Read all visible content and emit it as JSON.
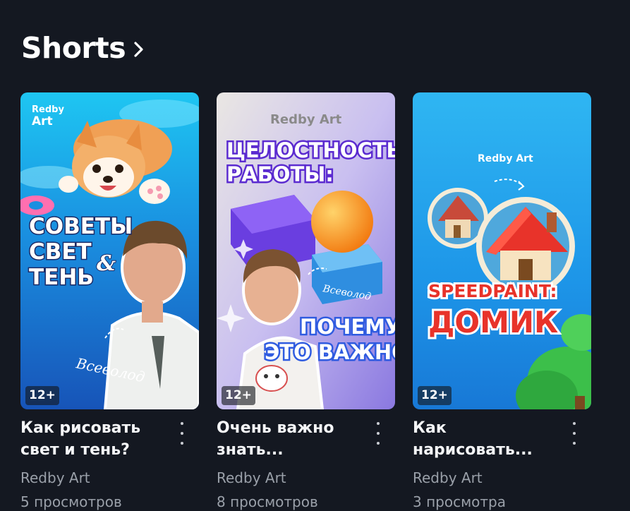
{
  "section": {
    "title": "Shorts",
    "chevron_icon": "chevron-right-icon"
  },
  "colors": {
    "background": "#141821",
    "title_text": "#f5f6f8",
    "secondary_text": "#9aa0a9"
  },
  "cards": [
    {
      "title": "Как рисовать\nсвет и тень?",
      "channel": "Redby Art",
      "views": "5 просмотров",
      "age_rating": "12+",
      "thumbnail": {
        "brand_line1": "Redby",
        "brand_line2": "Art",
        "text_lines": [
          "СОВЕТЫ",
          "СВЕТ",
          "ТЕНЬ"
        ],
        "accent": "&",
        "signature": "Всеволод"
      }
    },
    {
      "title": "Очень важно\nзнать...",
      "channel": "Redby Art",
      "views": "8 просмотров",
      "age_rating": "12+",
      "thumbnail": {
        "brand": "Redby Art",
        "headline_lines": [
          "ЦЕЛОСТНОСТЬ",
          "РАБОТЫ:"
        ],
        "bottom_lines": [
          "ПОЧЕМУ",
          "ЭТО ВАЖНО"
        ],
        "signature": "Всеволод"
      }
    },
    {
      "title": "Как\nнарисовать...",
      "channel": "Redby Art",
      "views": "3 просмотра",
      "age_rating": "12+",
      "thumbnail": {
        "brand": "Redby Art",
        "headline_lines": [
          "SPEEDPAINT:",
          "ДОМИК"
        ]
      }
    }
  ]
}
